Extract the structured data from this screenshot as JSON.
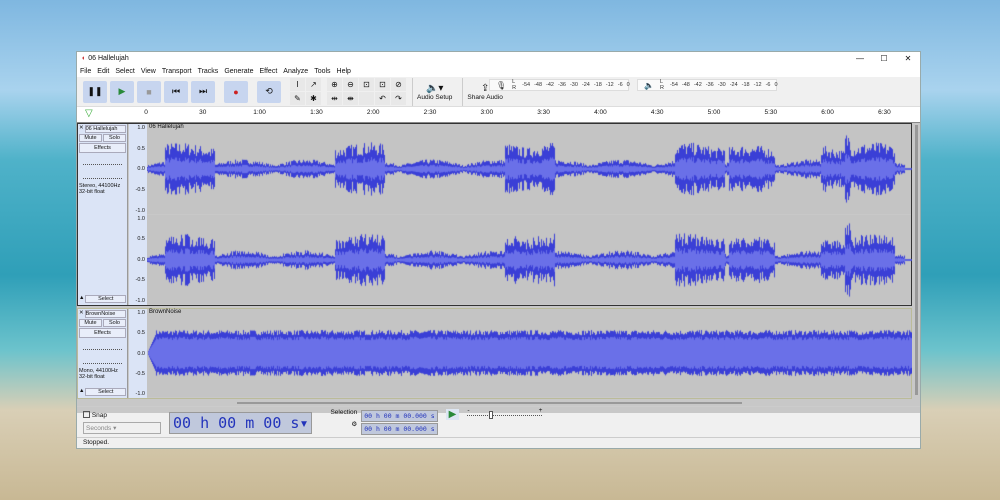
{
  "window": {
    "title": "06 Hallelujah",
    "controls": [
      "—",
      "☐",
      "✕"
    ]
  },
  "menu": [
    "File",
    "Edit",
    "Select",
    "View",
    "Transport",
    "Tracks",
    "Generate",
    "Effect",
    "Analyze",
    "Tools",
    "Help"
  ],
  "transport": [
    {
      "name": "pause",
      "glyph": "❚❚"
    },
    {
      "name": "play",
      "glyph": "▶"
    },
    {
      "name": "stop",
      "glyph": "■"
    },
    {
      "name": "skip-start",
      "glyph": "⏮"
    },
    {
      "name": "skip-end",
      "glyph": "⏭"
    },
    {
      "name": "record",
      "glyph": "●"
    },
    {
      "name": "loop",
      "glyph": "⟲"
    }
  ],
  "tools": [
    "I",
    "↗",
    "✎",
    "✱"
  ],
  "zoom_tools": [
    "⊕",
    "⊖",
    "⊡",
    "⊡",
    "⊘",
    "⇹",
    "⇼",
    "",
    "↶",
    "↷"
  ],
  "audio_setup": "Audio Setup",
  "share_audio": "Share Audio",
  "meter_ticks": [
    "-54",
    "-48",
    "-42",
    "-36",
    "-30",
    "-24",
    "-18",
    "-12",
    "-6",
    "0"
  ],
  "ruler": [
    "0",
    "30",
    "1:00",
    "1:30",
    "2:00",
    "2:30",
    "3:00",
    "3:30",
    "4:00",
    "4:30",
    "5:00",
    "5:30",
    "6:00",
    "6:30"
  ],
  "tracks": [
    {
      "name": "06 Hallelujah",
      "mute": "Mute",
      "solo": "Solo",
      "effects": "Effects",
      "info1": "Stereo, 44100Hz",
      "info2": "32-bit float",
      "select": "Select",
      "scale": [
        "1.0",
        "0.5",
        "0.0",
        "-0.5",
        "-1.0"
      ]
    },
    {
      "name": "BrownNoise",
      "mute": "Mute",
      "solo": "Solo",
      "effects": "Effects",
      "info1": "Mono, 44100Hz",
      "info2": "32-bit float",
      "select": "Select",
      "scale": [
        "1.0",
        "0.5",
        "0.0",
        "-0.5",
        "-1.0"
      ]
    }
  ],
  "colors": {
    "wave": "#3a3fd6",
    "rms": "#6a70e8"
  },
  "bottom": {
    "snap": "Snap",
    "snap_unit": "Seconds",
    "time": "00 h 00 m 00 s",
    "selection": "Selection",
    "sel_start": "00 h 00 m 00.000 s",
    "sel_end": "00 h 00 m 00.000 s",
    "speed_min": "-",
    "speed_max": "+"
  },
  "status": "Stopped."
}
